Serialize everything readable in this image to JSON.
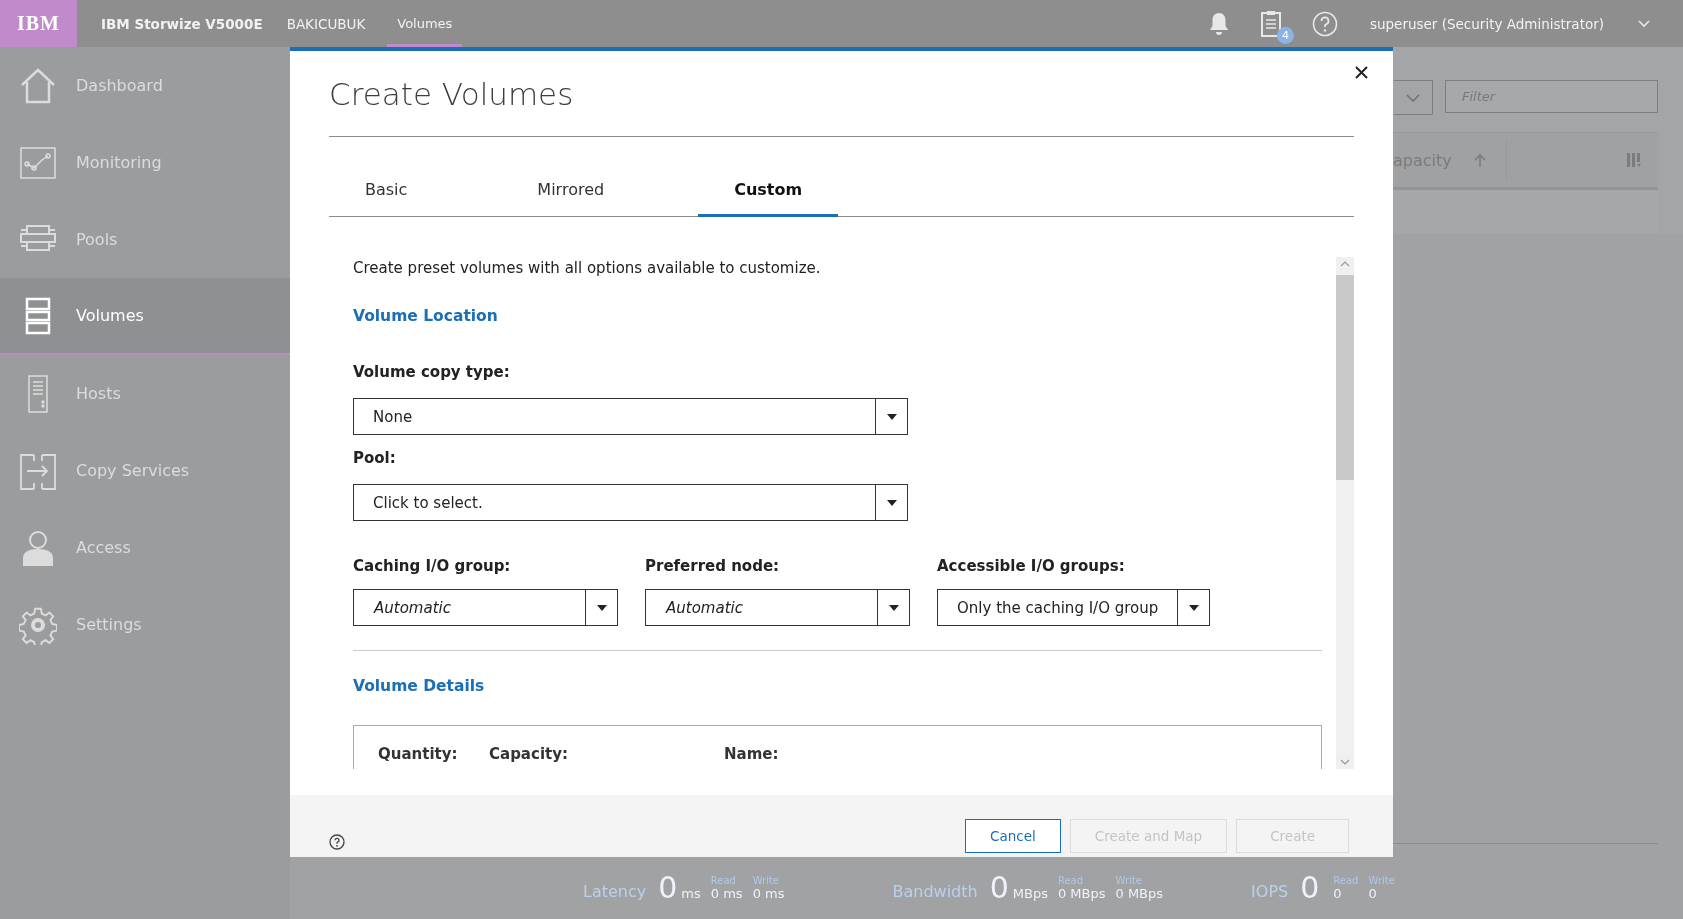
{
  "header": {
    "logo": "IBM",
    "product": "IBM Storwize V5000E",
    "system": "BAKICUBUK",
    "breadcrumb": "Volumes",
    "tasks_badge": "4",
    "user": "superuser (Security Administrator)"
  },
  "sidebar": {
    "items": [
      {
        "label": "Dashboard",
        "kind": "house",
        "selected": false
      },
      {
        "label": "Monitoring",
        "kind": "monitor",
        "selected": false
      },
      {
        "label": "Pools",
        "kind": "pools",
        "selected": false
      },
      {
        "label": "Volumes",
        "kind": "volumes",
        "selected": true
      },
      {
        "label": "Hosts",
        "kind": "hosts",
        "selected": false
      },
      {
        "label": "Copy Services",
        "kind": "copy",
        "selected": false
      },
      {
        "label": "Access",
        "kind": "access",
        "selected": false
      },
      {
        "label": "Settings",
        "kind": "settings",
        "selected": false
      }
    ]
  },
  "background": {
    "filter_placeholder": "Filter",
    "column_header": "apacity"
  },
  "status_bar": {
    "metrics": [
      {
        "label": "Latency",
        "value": "0",
        "unit": "ms",
        "read_label": "Read",
        "read": "0 ms",
        "write_label": "Write",
        "write": "0 ms"
      },
      {
        "label": "Bandwidth",
        "value": "0",
        "unit": "MBps",
        "read_label": "Read",
        "read": "0 MBps",
        "write_label": "Write",
        "write": "0 MBps"
      },
      {
        "label": "IOPS",
        "value": "0",
        "read_label": "Read",
        "read": "0",
        "write_label": "Write",
        "write": "0"
      }
    ]
  },
  "dialog": {
    "title": "Create Volumes",
    "tabs": [
      {
        "label": "Basic",
        "selected": false
      },
      {
        "label": "Mirrored",
        "selected": false
      },
      {
        "label": "Custom",
        "selected": true
      }
    ],
    "description": "Create preset volumes with all options available to customize.",
    "location": {
      "title": "Volume Location",
      "fields": [
        {
          "label": "Volume copy type:",
          "value": "None",
          "default_value": false
        },
        {
          "label": "Pool:",
          "value": "Click to select.",
          "default_value": false
        }
      ],
      "group_fields": [
        {
          "label": "Caching I/O group:",
          "value": "Automatic",
          "default_value": true
        },
        {
          "label": "Preferred node:",
          "value": "Automatic",
          "default_value": true
        },
        {
          "label": "Accessible I/O groups:",
          "value": "Only the caching I/O group",
          "default_value": false
        }
      ]
    },
    "details": {
      "title": "Volume Details",
      "columns": [
        "Quantity:",
        "Capacity:",
        "Name:"
      ]
    },
    "buttons": [
      {
        "label": "Cancel",
        "disabled": false
      },
      {
        "label": "Create and Map",
        "disabled": true
      },
      {
        "label": "Create",
        "disabled": true
      }
    ]
  }
}
